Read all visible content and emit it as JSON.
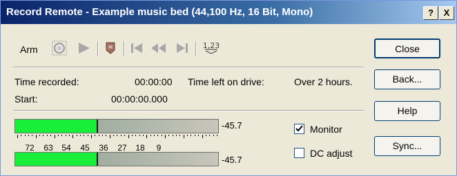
{
  "window": {
    "title": "Record Remote - Example music bed (44,100 Hz, 16 Bit, Mono)",
    "help_btn": "?",
    "close_btn": "X"
  },
  "toolbar": {
    "arm_label": "Arm",
    "counter_icon_text": "1,23"
  },
  "status": {
    "time_recorded_label": "Time recorded:",
    "time_recorded_value": "00:00:00",
    "time_left_label": "Time left on drive:",
    "time_left_value": "Over 2 hours.",
    "start_label": "Start:",
    "start_value": "00:00:00.000"
  },
  "meters": {
    "top_value": "-45.7",
    "bottom_value": "-45.7",
    "scale_labels": [
      "72",
      "63",
      "54",
      "45",
      "36",
      "27",
      "18",
      "9"
    ]
  },
  "options": {
    "monitor_label": "Monitor",
    "monitor_checked": true,
    "dc_adjust_label": "DC adjust",
    "dc_adjust_checked": false
  },
  "buttons": {
    "close": "Close",
    "back": "Back...",
    "help": "Help",
    "sync": "Sync..."
  }
}
